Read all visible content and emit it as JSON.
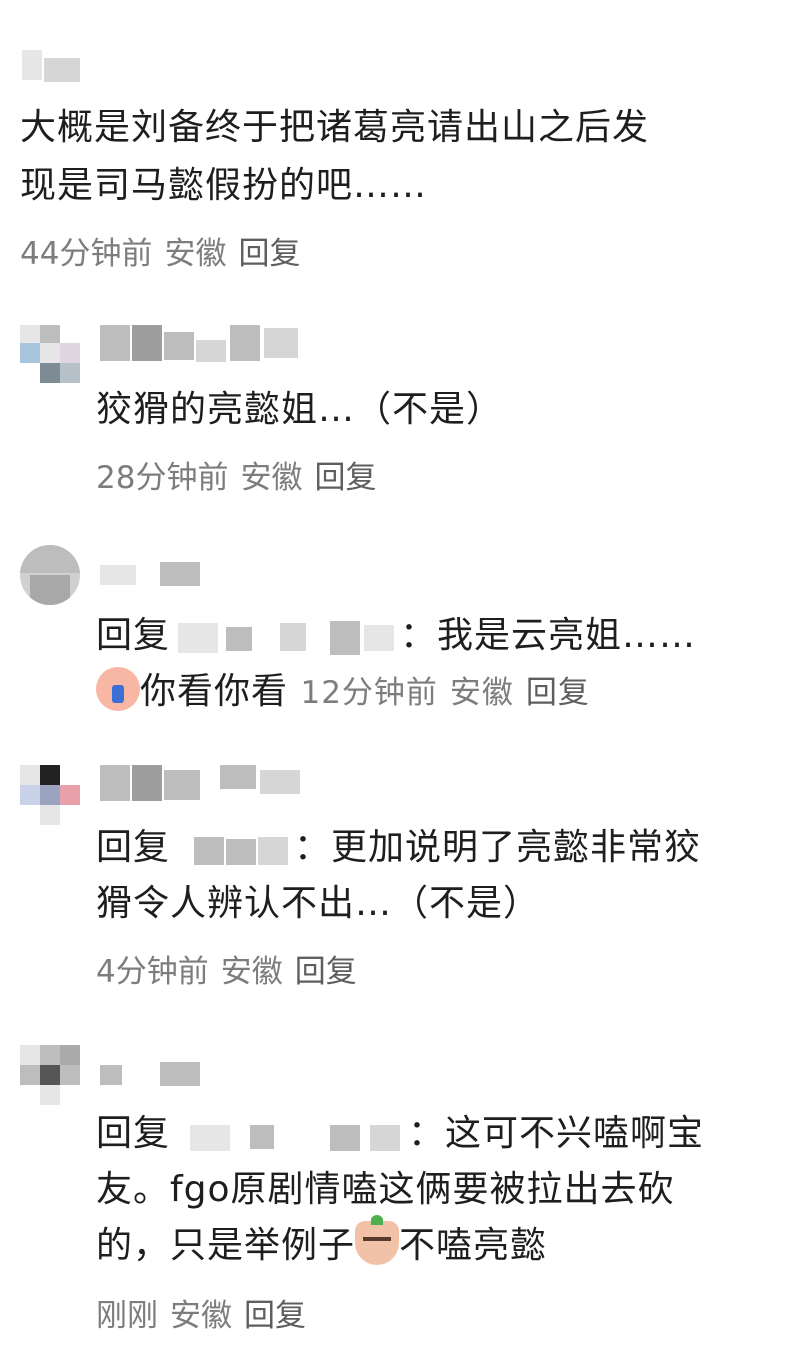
{
  "comments": [
    {
      "text": "大概是刘备终于把诸葛亮请出山之后发现是司马懿假扮的吧……",
      "line1": "大概是刘备终于把诸葛亮请出山之后发",
      "line2": "现是司马懿假扮的吧……",
      "time": "44分钟前",
      "location": "安徽",
      "reply_label": "回复"
    },
    {
      "text": "狡猾的亮懿姐…（不是）",
      "time": "28分钟前",
      "location": "安徽",
      "reply_label": "回复"
    },
    {
      "reply_prefix": "回复",
      "line1_suffix": "：我是云亮姐……",
      "line2_text": "你看你看",
      "emoji": "crying-emoji",
      "time": "12分钟前",
      "location": "安徽",
      "reply_label": "回复"
    },
    {
      "reply_prefix": "回复",
      "line1_suffix": "：更加说明了亮懿非常狡",
      "line2": "猾令人辨认不出…（不是）",
      "time": "4分钟前",
      "location": "安徽",
      "reply_label": "回复"
    },
    {
      "reply_prefix": "回复",
      "line1_suffix": "：这可不兴嗑啊宝",
      "line2": "友。fgo原剧情嗑这俩要被拉出去砍",
      "line3_pre": "的，只是举例子",
      "line3_post": "不嗑亮懿",
      "emoji": "sly-emoji",
      "time": "刚刚",
      "location": "安徽",
      "reply_label": "回复"
    }
  ]
}
